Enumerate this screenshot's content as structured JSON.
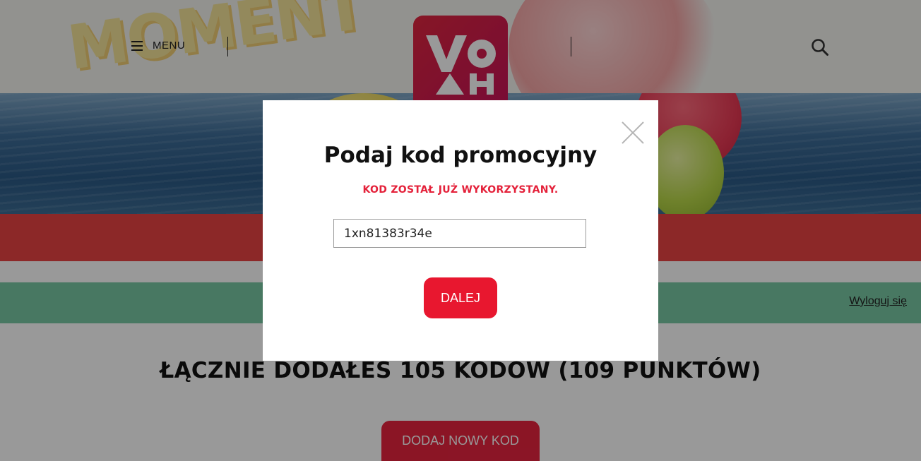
{
  "header": {
    "menu_label": "MENU",
    "logo_letters": [
      "V",
      "O",
      "A",
      "H"
    ],
    "colors": {
      "logo": "#e0263f"
    }
  },
  "page": {
    "logout_label": "Wyloguj się",
    "total_text": "ŁĄCZNIE DODAŁEŚ 105 KODÓW (109 PUNKTÓW)",
    "add_code_label": "DODAJ NOWY KOD",
    "colors": {
      "red_band": "#e94343",
      "green_band": "#79c8a4",
      "accent": "#e8233f"
    }
  },
  "modal": {
    "title": "Podaj kod promocyjny",
    "error": "KOD ZOSTAŁ JUŻ WYKORZYSTANY.",
    "code_value": "1xn81383r34e",
    "next_label": "DALEJ",
    "close_icon": "close-icon"
  },
  "icons": {
    "menu": "hamburger-icon",
    "search": "search-icon",
    "close": "close-icon"
  }
}
